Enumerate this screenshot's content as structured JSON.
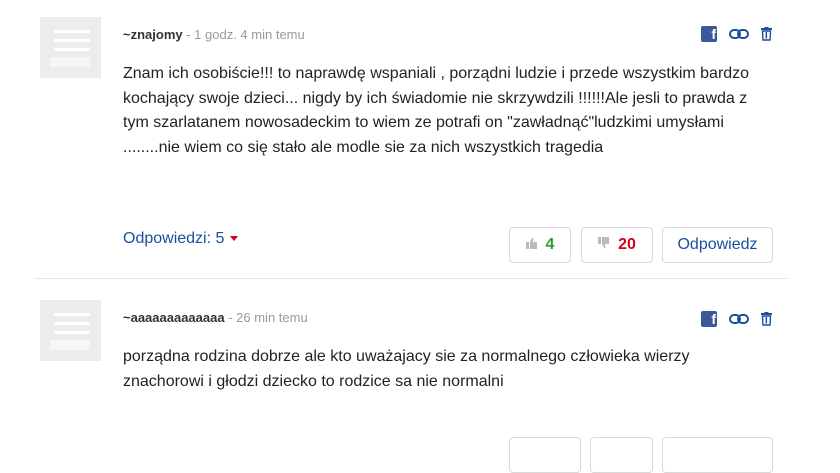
{
  "comments": [
    {
      "author": "~znajomy",
      "time": "- 1 godz. 4 min temu",
      "body": "Znam ich osobiście!!! to naprawdę wspaniali , porządni ludzie i przede wszystkim bardzo kochający swoje dzieci... nigdy by ich świadomie nie skrzywdzili !!!!!!Ale jesli to prawda z tym szarlatanem nowosadeckim to wiem ze potrafi on \"zawładnąć\"ludzkimi umysłami ........nie wiem co się stało ale modle sie za nich wszystkich tragedia",
      "replies_label": "Odpowiedzi: 5",
      "upvotes": "4",
      "downvotes": "20",
      "reply_label": "Odpowiedz"
    },
    {
      "author": "~aaaaaaaaaaaaa",
      "time": "- 26 min temu",
      "body": "porządna rodzina dobrze ale kto uważajacy sie za normalnego człowieka wierzy znachorowi i głodzi dziecko to rodzice sa nie normalni"
    }
  ],
  "icons": {
    "facebook": "facebook-icon",
    "link": "link-icon",
    "delete": "trash-icon",
    "thumb_up": "thumb-up-icon",
    "thumb_down": "thumb-down-icon",
    "caret": "caret-down-icon"
  },
  "colors": {
    "link": "#1a4f9e",
    "upvote": "#2aa02a",
    "downvote": "#d0021b",
    "facebook": "#3b5998"
  }
}
